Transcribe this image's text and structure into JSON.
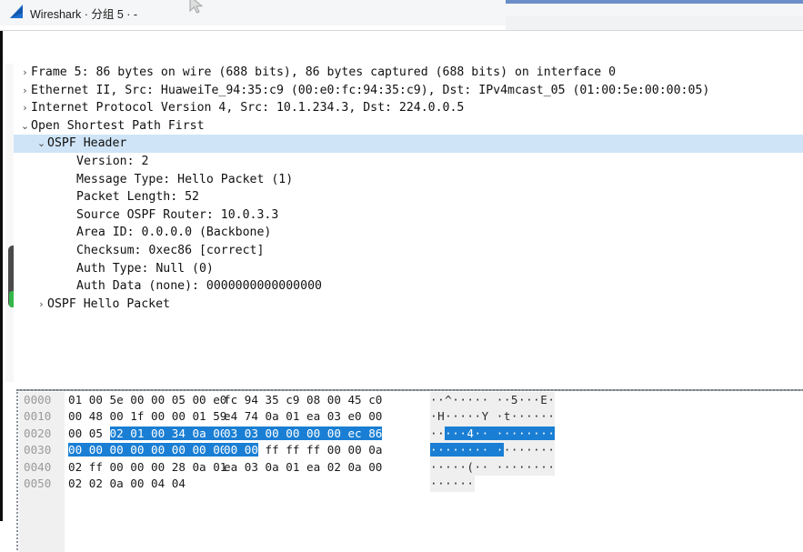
{
  "window": {
    "title": "Wireshark · 分组 5 · -",
    "logo_name": "wireshark-fin-logo",
    "accent_color": "#6b8ec9",
    "selection_color": "#cfe4f7",
    "hex_highlight_color": "#1a7fd4"
  },
  "tree": [
    {
      "twisty": "›",
      "indent": 0,
      "selected": false,
      "label": "Frame 5: 86 bytes on wire (688 bits), 86 bytes captured (688 bits) on interface 0",
      "name": "tree-item-frame"
    },
    {
      "twisty": "›",
      "indent": 0,
      "selected": false,
      "label": "Ethernet II, Src: HuaweiTe_94:35:c9 (00:e0:fc:94:35:c9), Dst: IPv4mcast_05 (01:00:5e:00:00:05)",
      "name": "tree-item-ethernet"
    },
    {
      "twisty": "›",
      "indent": 0,
      "selected": false,
      "label": "Internet Protocol Version 4, Src: 10.1.234.3, Dst: 224.0.0.5",
      "name": "tree-item-ipv4"
    },
    {
      "twisty": "⌄",
      "indent": 0,
      "selected": false,
      "label": "Open Shortest Path First",
      "name": "tree-item-ospf"
    },
    {
      "twisty": "⌄",
      "indent": 1,
      "selected": true,
      "label": "OSPF Header",
      "name": "tree-item-ospf-header"
    },
    {
      "twisty": "",
      "indent": 2,
      "selected": false,
      "label": "Version: 2",
      "name": "tree-field-version"
    },
    {
      "twisty": "",
      "indent": 2,
      "selected": false,
      "label": "Message Type: Hello Packet (1)",
      "name": "tree-field-message-type"
    },
    {
      "twisty": "",
      "indent": 2,
      "selected": false,
      "label": "Packet Length: 52",
      "name": "tree-field-packet-length"
    },
    {
      "twisty": "",
      "indent": 2,
      "selected": false,
      "label": "Source OSPF Router: 10.0.3.3",
      "name": "tree-field-source-router"
    },
    {
      "twisty": "",
      "indent": 2,
      "selected": false,
      "label": "Area ID: 0.0.0.0 (Backbone)",
      "name": "tree-field-area-id"
    },
    {
      "twisty": "",
      "indent": 2,
      "selected": false,
      "label": "Checksum: 0xec86 [correct]",
      "name": "tree-field-checksum"
    },
    {
      "twisty": "",
      "indent": 2,
      "selected": false,
      "label": "Auth Type: Null (0)",
      "name": "tree-field-auth-type"
    },
    {
      "twisty": "",
      "indent": 2,
      "selected": false,
      "label": "Auth Data (none): 0000000000000000",
      "name": "tree-field-auth-data"
    },
    {
      "twisty": "›",
      "indent": 1,
      "selected": false,
      "label": "OSPF Hello Packet",
      "name": "tree-item-ospf-hello"
    }
  ],
  "hex": {
    "rows": [
      {
        "offset": "0000",
        "group1": "01 00 5e 00 00 05 00 e0",
        "group2": "fc 94 35 c9 08 00 45 c0",
        "ascii": "··^····· ··5···E·",
        "sel_g1": [
          0,
          0
        ],
        "sel_g2": [
          0,
          0
        ],
        "sel_ascii": [
          0,
          0
        ]
      },
      {
        "offset": "0010",
        "group1": "00 48 00 1f 00 00 01 59",
        "group2": "e4 74 0a 01 ea 03 e0 00",
        "ascii": "·H·····Y ·t······",
        "sel_g1": [
          0,
          0
        ],
        "sel_g2": [
          0,
          0
        ],
        "sel_ascii": [
          0,
          0
        ]
      },
      {
        "offset": "0020",
        "group1": "00 05 02 01 00 34 0a 00",
        "group2": "03 03 00 00 00 00 ec 86",
        "ascii": "·····4·· ········",
        "sel_g1": [
          6,
          23
        ],
        "sel_g2": [
          0,
          23
        ],
        "sel_ascii": [
          2,
          17
        ]
      },
      {
        "offset": "0030",
        "group1": "00 00 00 00 00 00 00 00",
        "group2": "00 00 ff ff ff 00 00 0a",
        "ascii": "········ ········",
        "sel_g1": [
          0,
          23
        ],
        "sel_g2": [
          0,
          5
        ],
        "sel_ascii": [
          0,
          10
        ]
      },
      {
        "offset": "0040",
        "group1": "02 ff 00 00 00 28 0a 01",
        "group2": "ea 03 0a 01 ea 02 0a 00",
        "ascii": "·····(·· ········",
        "sel_g1": [
          0,
          0
        ],
        "sel_g2": [
          0,
          0
        ],
        "sel_ascii": [
          0,
          0
        ]
      },
      {
        "offset": "0050",
        "group1": "02 02 0a 00 04 04",
        "group2": "",
        "ascii": "······",
        "sel_g1": [
          0,
          0
        ],
        "sel_g2": [
          0,
          0
        ],
        "sel_ascii": [
          0,
          0
        ]
      }
    ]
  }
}
